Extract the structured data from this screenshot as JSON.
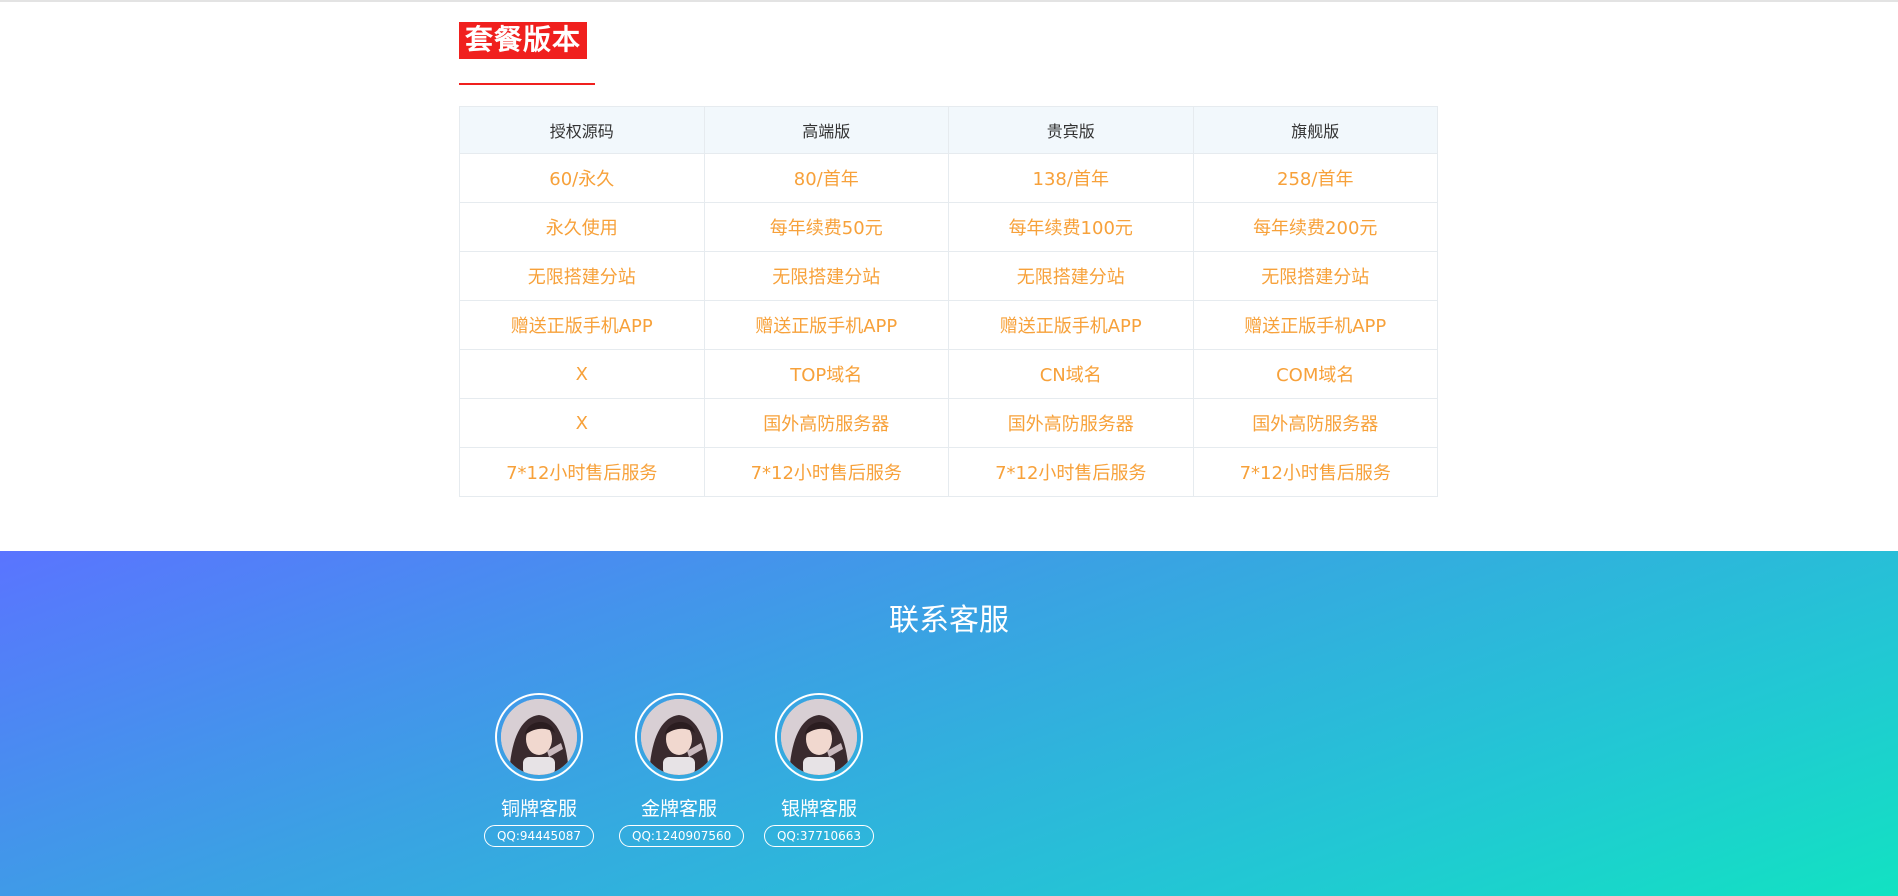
{
  "section": {
    "title": "套餐版本"
  },
  "table": {
    "headers": [
      "授权源码",
      "高端版",
      "贵宾版",
      "旗舰版"
    ],
    "rows": [
      [
        "60/永久",
        "80/首年",
        "138/首年",
        "258/首年"
      ],
      [
        "永久使用",
        "每年续费50元",
        "每年续费100元",
        "每年续费200元"
      ],
      [
        "无限搭建分站",
        "无限搭建分站",
        "无限搭建分站",
        "无限搭建分站"
      ],
      [
        "赠送正版手机APP",
        "赠送正版手机APP",
        "赠送正版手机APP",
        "赠送正版手机APP"
      ],
      [
        "X",
        "TOP域名",
        "CN域名",
        "COM域名"
      ],
      [
        "X",
        "国外高防服务器",
        "国外高防服务器",
        "国外高防服务器"
      ],
      [
        "7*12小时售后服务",
        "7*12小时售后服务",
        "7*12小时售后服务",
        "7*12小时售后服务"
      ]
    ]
  },
  "contact": {
    "title": "联系客服",
    "agents": [
      {
        "name": "铜牌客服",
        "qq": "QQ:94445087",
        "avatar_icon": "agent-avatar-photo"
      },
      {
        "name": "金牌客服",
        "qq": "QQ:1240907560",
        "avatar_icon": "agent-avatar-photo"
      },
      {
        "name": "银牌客服",
        "qq": "QQ:37710663",
        "avatar_icon": "agent-avatar-photo"
      }
    ]
  },
  "colors": {
    "accent_red": "#f0201e",
    "price_orange": "#f7a13a",
    "gradient_start": "#5a74ff",
    "gradient_end": "#12e2c2"
  }
}
